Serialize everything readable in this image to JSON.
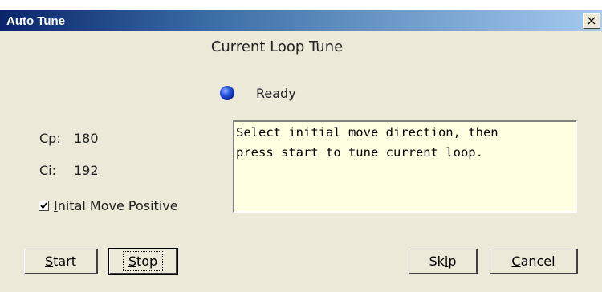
{
  "window": {
    "title": "Auto Tune",
    "close_glyph": "×"
  },
  "heading": "Current Loop Tune",
  "status": {
    "text": "Ready",
    "light_color": "#1f4fe0"
  },
  "message": "Select initial move direction, then\npress start to tune current loop.",
  "params": {
    "cp_label": "Cp:",
    "cp_value": "180",
    "ci_label": "Ci:",
    "ci_value": "192"
  },
  "checkbox": {
    "label_first": "I",
    "label_rest": "nital Move Positive",
    "checked": true
  },
  "buttons": {
    "start_first": "S",
    "start_rest": "tart",
    "stop_first": "S",
    "stop_rest": "top",
    "skip_first": "Sk",
    "skip_mid": "i",
    "skip_rest": "p",
    "cancel_first": "C",
    "cancel_rest": "ancel"
  }
}
